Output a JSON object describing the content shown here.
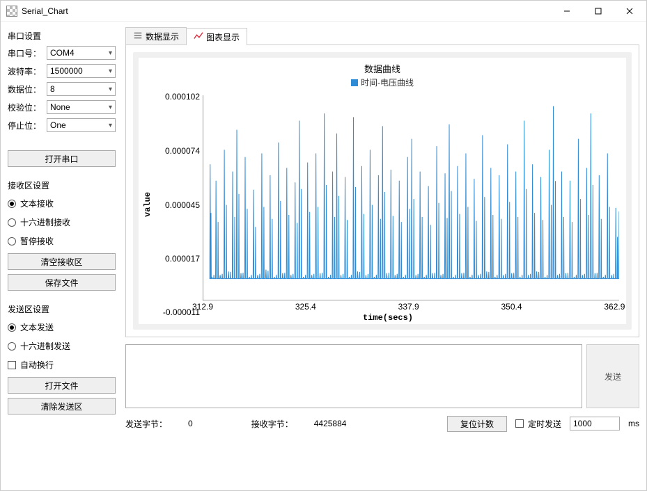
{
  "window": {
    "title": "Serial_Chart"
  },
  "sidebar": {
    "port_section": "串口设置",
    "rows": {
      "port": {
        "label": "串口号：",
        "value": "COM4"
      },
      "baud": {
        "label": "波特率：",
        "value": "1500000"
      },
      "data": {
        "label": "数据位：",
        "value": "8"
      },
      "parity": {
        "label": "校验位：",
        "value": "None"
      },
      "stop": {
        "label": "停止位：",
        "value": "One"
      }
    },
    "open_port_btn": "打开串口",
    "recv_section": "接收区设置",
    "recv_text": "文本接收",
    "recv_hex": "十六进制接收",
    "recv_pause": "暂停接收",
    "clear_recv_btn": "清空接收区",
    "save_file_btn": "保存文件",
    "send_section": "发送区设置",
    "send_text": "文本发送",
    "send_hex": "十六进制发送",
    "auto_wrap": "自动换行",
    "open_file_btn": "打开文件",
    "clear_send_btn": "清除发送区"
  },
  "tabs": {
    "data": "数据显示",
    "chart": "图表显示"
  },
  "chart": {
    "title": "数据曲线",
    "legend": "时间-电压曲线",
    "xlabel": "time(secs)",
    "ylabel": "value",
    "yticks": [
      "0.000102",
      "0.000074",
      "0.000045",
      "0.000017",
      "-0.000011"
    ],
    "xticks": [
      "312.9",
      "325.4",
      "337.9",
      "350.4",
      "362.9"
    ]
  },
  "chart_data": {
    "type": "line",
    "title": "数据曲线",
    "xlabel": "time(secs)",
    "ylabel": "value",
    "xlim": [
      312.9,
      362.9
    ],
    "ylim": [
      -1.1e-05,
      0.000102
    ],
    "series": [
      {
        "name": "时间-电压曲线",
        "color": "#2e8bd6",
        "note": "dense noisy voltage-vs-time trace; values fluctuate rapidly between ~0 and ~0.00009 with a baseline near 0; representative sampled points below",
        "x": [
          313.8,
          314.0,
          314.5,
          315.0,
          315.5,
          316.0,
          316.5,
          317.0,
          317.5,
          318.0,
          318.5,
          319.0,
          319.5,
          320.0,
          320.5,
          321.0,
          321.5,
          322.0,
          322.5,
          323.0,
          323.5,
          324.0,
          324.5,
          325.0,
          325.5,
          326.0,
          326.5,
          327.0,
          327.5,
          328.0,
          328.5,
          329.0,
          329.5,
          330.0,
          330.5,
          331.0,
          331.5,
          332.0,
          332.5,
          333.0,
          333.5,
          334.0,
          334.5,
          335.0,
          335.5,
          336.0,
          336.5,
          337.0,
          337.5,
          338.0,
          338.5,
          339.0,
          339.5,
          340.0,
          340.5,
          341.0,
          341.5,
          342.0,
          342.5,
          343.0,
          343.5,
          344.0,
          344.5,
          345.0,
          345.5,
          346.0,
          346.5,
          347.0,
          347.5,
          348.0,
          348.5,
          349.0,
          349.5,
          350.0,
          350.5,
          351.0,
          351.5,
          352.0,
          352.5,
          353.0,
          353.5,
          354.0,
          354.5,
          355.0,
          355.5,
          356.0,
          356.5,
          357.0,
          357.5,
          358.0,
          358.5,
          359.0,
          359.5,
          360.0,
          360.5,
          361.0,
          361.5,
          362.0,
          362.5,
          362.9
        ],
        "y": [
          6.4e-05,
          2e-06,
          5.5e-05,
          3e-06,
          7.2e-05,
          5e-06,
          6e-05,
          8.3e-05,
          4e-06,
          6.8e-05,
          2e-06,
          5e-05,
          3e-06,
          7e-05,
          6e-06,
          5.8e-05,
          2e-06,
          7.6e-05,
          4e-06,
          6.2e-05,
          3e-06,
          5.4e-05,
          8.8e-05,
          2e-06,
          6.5e-05,
          3e-06,
          7e-05,
          4e-06,
          9.2e-05,
          2e-06,
          6e-05,
          8.1e-05,
          3e-06,
          5.7e-05,
          2e-06,
          9e-05,
          5e-06,
          6.3e-05,
          3e-06,
          7.2e-05,
          2e-06,
          5.8e-05,
          8.5e-05,
          4e-06,
          6.1e-05,
          3e-06,
          5.5e-05,
          2e-06,
          6.8e-05,
          7.8e-05,
          3e-06,
          6e-05,
          2e-06,
          5.2e-05,
          4e-06,
          7.4e-05,
          3e-06,
          5.9e-05,
          8.6e-05,
          2e-06,
          6.3e-05,
          4e-06,
          7e-05,
          2e-06,
          5.6e-05,
          3e-06,
          8e-05,
          5e-06,
          6.2e-05,
          2e-06,
          5.8e-05,
          3e-06,
          7.5e-05,
          4e-06,
          6e-05,
          2e-06,
          8.8e-05,
          3e-06,
          6.4e-05,
          5e-06,
          5.7e-05,
          2e-06,
          7.2e-05,
          9.6e-05,
          3e-06,
          6e-05,
          4e-06,
          5.5e-05,
          2e-06,
          7.8e-05,
          3e-06,
          6.2e-05,
          9.2e-05,
          4e-06,
          5.8e-05,
          2e-06,
          7e-05,
          3e-06,
          4e-05,
          3.8e-05
        ]
      }
    ]
  },
  "send": {
    "button": "发送",
    "value": ""
  },
  "status": {
    "sent_label": "发送字节：",
    "sent_value": "0",
    "recv_label": "接收字节：",
    "recv_value": "4425884",
    "reset_btn": "复位计数",
    "timed_send": "定时发送",
    "interval_value": "1000",
    "interval_unit": "ms"
  }
}
